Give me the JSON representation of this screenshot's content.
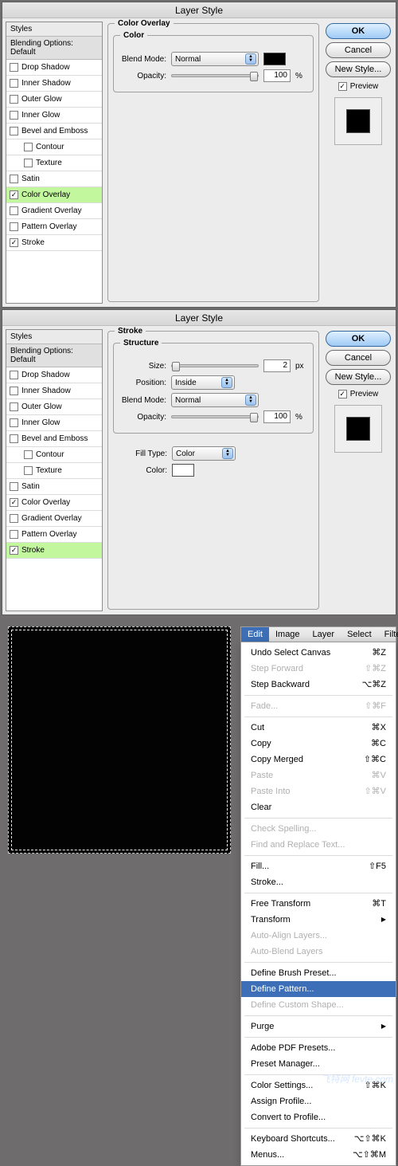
{
  "dialog1": {
    "title": "Layer Style",
    "styles_header": "Styles",
    "blending_header": "Blending Options: Default",
    "style_items": [
      {
        "label": "Drop Shadow",
        "checked": false
      },
      {
        "label": "Inner Shadow",
        "checked": false
      },
      {
        "label": "Outer Glow",
        "checked": false
      },
      {
        "label": "Inner Glow",
        "checked": false
      },
      {
        "label": "Bevel and Emboss",
        "checked": false
      },
      {
        "label": "Contour",
        "checked": false,
        "indent": true
      },
      {
        "label": "Texture",
        "checked": false,
        "indent": true
      },
      {
        "label": "Satin",
        "checked": false
      },
      {
        "label": "Color Overlay",
        "checked": true,
        "selected": true
      },
      {
        "label": "Gradient Overlay",
        "checked": false
      },
      {
        "label": "Pattern Overlay",
        "checked": false
      },
      {
        "label": "Stroke",
        "checked": true
      }
    ],
    "panel_title": "Color Overlay",
    "group_title": "Color",
    "blend_mode": {
      "label": "Blend Mode:",
      "value": "Normal"
    },
    "opacity": {
      "label": "Opacity:",
      "value": "100",
      "unit": "%"
    },
    "swatch_color": "#000000",
    "buttons": {
      "ok": "OK",
      "cancel": "Cancel",
      "new_style": "New Style..."
    },
    "preview": {
      "label": "Preview",
      "checked": true
    }
  },
  "dialog2": {
    "title": "Layer Style",
    "styles_header": "Styles",
    "blending_header": "Blending Options: Default",
    "style_items": [
      {
        "label": "Drop Shadow",
        "checked": false
      },
      {
        "label": "Inner Shadow",
        "checked": false
      },
      {
        "label": "Outer Glow",
        "checked": false
      },
      {
        "label": "Inner Glow",
        "checked": false
      },
      {
        "label": "Bevel and Emboss",
        "checked": false
      },
      {
        "label": "Contour",
        "checked": false,
        "indent": true
      },
      {
        "label": "Texture",
        "checked": false,
        "indent": true
      },
      {
        "label": "Satin",
        "checked": false
      },
      {
        "label": "Color Overlay",
        "checked": true
      },
      {
        "label": "Gradient Overlay",
        "checked": false
      },
      {
        "label": "Pattern Overlay",
        "checked": false
      },
      {
        "label": "Stroke",
        "checked": true,
        "selected": true
      }
    ],
    "panel_title": "Stroke",
    "structure_title": "Structure",
    "size": {
      "label": "Size:",
      "value": "2",
      "unit": "px"
    },
    "position": {
      "label": "Position:",
      "value": "Inside"
    },
    "blend_mode": {
      "label": "Blend Mode:",
      "value": "Normal"
    },
    "opacity": {
      "label": "Opacity:",
      "value": "100",
      "unit": "%"
    },
    "fill_type": {
      "label": "Fill Type:",
      "value": "Color"
    },
    "color": {
      "label": "Color:",
      "value": "#ffffff"
    },
    "buttons": {
      "ok": "OK",
      "cancel": "Cancel",
      "new_style": "New Style..."
    },
    "preview": {
      "label": "Preview",
      "checked": true
    }
  },
  "section3": {
    "menubar": [
      "Edit",
      "Image",
      "Layer",
      "Select",
      "Filte"
    ],
    "active_menu": "Edit",
    "menu": [
      {
        "label": "Undo Select Canvas",
        "sc": "⌘Z"
      },
      {
        "label": "Step Forward",
        "sc": "⇧⌘Z",
        "disabled": true
      },
      {
        "label": "Step Backward",
        "sc": "⌥⌘Z"
      },
      {
        "sep": true
      },
      {
        "label": "Fade...",
        "sc": "⇧⌘F",
        "disabled": true
      },
      {
        "sep": true
      },
      {
        "label": "Cut",
        "sc": "⌘X"
      },
      {
        "label": "Copy",
        "sc": "⌘C"
      },
      {
        "label": "Copy Merged",
        "sc": "⇧⌘C"
      },
      {
        "label": "Paste",
        "sc": "⌘V",
        "disabled": true
      },
      {
        "label": "Paste Into",
        "sc": "⇧⌘V",
        "disabled": true
      },
      {
        "label": "Clear",
        "sc": ""
      },
      {
        "sep": true
      },
      {
        "label": "Check Spelling...",
        "disabled": true
      },
      {
        "label": "Find and Replace Text...",
        "disabled": true
      },
      {
        "sep": true
      },
      {
        "label": "Fill...",
        "sc": "⇧F5"
      },
      {
        "label": "Stroke...",
        "sc": ""
      },
      {
        "sep": true
      },
      {
        "label": "Free Transform",
        "sc": "⌘T"
      },
      {
        "label": "Transform",
        "sub": true
      },
      {
        "label": "Auto-Align Layers...",
        "disabled": true
      },
      {
        "label": "Auto-Blend Layers",
        "disabled": true
      },
      {
        "sep": true
      },
      {
        "label": "Define Brush Preset..."
      },
      {
        "label": "Define Pattern...",
        "selected": true
      },
      {
        "label": "Define Custom Shape...",
        "disabled": true
      },
      {
        "sep": true
      },
      {
        "label": "Purge",
        "sub": true
      },
      {
        "sep": true
      },
      {
        "label": "Adobe PDF Presets..."
      },
      {
        "label": "Preset Manager..."
      },
      {
        "sep": true
      },
      {
        "label": "Color Settings...",
        "sc": "⇧⌘K"
      },
      {
        "label": "Assign Profile..."
      },
      {
        "label": "Convert to Profile..."
      },
      {
        "sep": true
      },
      {
        "label": "Keyboard Shortcuts...",
        "sc": "⌥⇧⌘K"
      },
      {
        "label": "Menus...",
        "sc": "⌥⇧⌘M"
      }
    ],
    "watermark": "飞特网\nfevte.com"
  }
}
